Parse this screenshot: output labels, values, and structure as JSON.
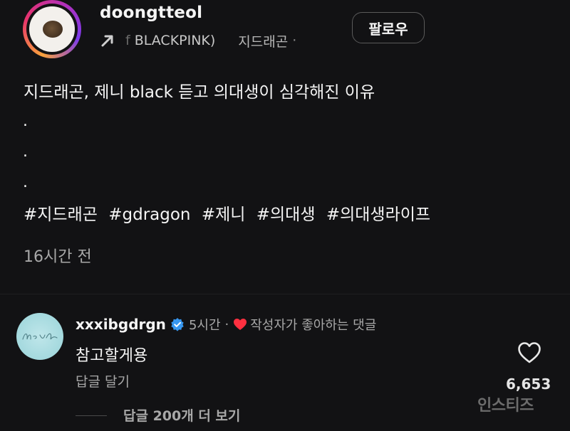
{
  "post": {
    "username": "doongtteol",
    "meta_prefix": "f",
    "meta_band": "BLACKPINK)",
    "meta_artist": "지드래곤",
    "meta_dot": "·",
    "follow_label": "팔로우",
    "caption_title": "지드래곤, 제니 black 듣고 의대생이 심각해진 이유",
    "caption_dots": [
      ".",
      ".",
      "."
    ],
    "hashtags": [
      "#지드래곤",
      "#gdragon",
      "#제니",
      "#의대생",
      "#의대생라이프"
    ],
    "time_ago": "16시간 전"
  },
  "comment": {
    "username": "xxxibgdrgn",
    "verified": true,
    "time": "5시간",
    "separator": "·",
    "liked_by_author_label": "작성자가 좋아하는 댓글",
    "text": "참고할게용",
    "reply_label": "답글 달기",
    "like_count": "6,653",
    "view_replies_label": "답글 200개 더 보기"
  },
  "watermark": "인스티즈",
  "colors": {
    "background": "#121214",
    "verified": "#3797f0",
    "heart": "#ff3040",
    "secondary_text": "#a8a8a8"
  },
  "icons": {
    "verified": "verified-badge-icon",
    "heart_small": "heart-filled-icon",
    "like": "heart-outline-icon",
    "arrow": "arrow-up-right-icon"
  }
}
